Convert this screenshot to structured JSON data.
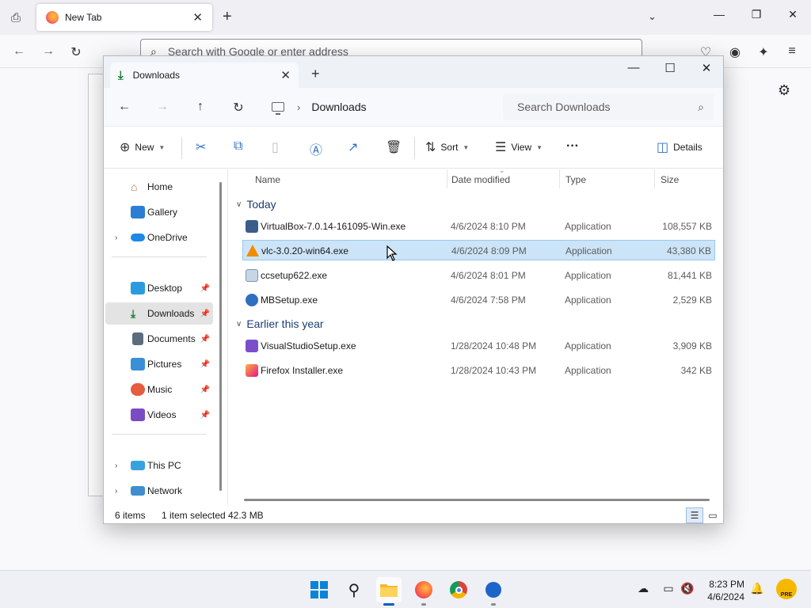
{
  "firefox": {
    "tab_title": "New Tab",
    "url_placeholder": "Search with Google or enter address"
  },
  "explorer": {
    "tab_title": "Downloads",
    "breadcrumb": "Downloads",
    "search_placeholder": "Search Downloads",
    "toolbar": {
      "new_label": "New",
      "sort_label": "Sort",
      "view_label": "View",
      "more_label": "···",
      "details_label": "Details"
    },
    "nav": {
      "home": "Home",
      "gallery": "Gallery",
      "onedrive": "OneDrive",
      "desktop": "Desktop",
      "downloads": "Downloads",
      "documents": "Documents",
      "pictures": "Pictures",
      "music": "Music",
      "videos": "Videos",
      "thispc": "This PC",
      "network": "Network"
    },
    "columns": {
      "name": "Name",
      "date": "Date modified",
      "type": "Type",
      "size": "Size"
    },
    "groups": {
      "today": "Today",
      "earlier": "Earlier this year"
    },
    "files": [
      {
        "name": "VirtualBox-7.0.14-161095-Win.exe",
        "date": "4/6/2024 8:10 PM",
        "type": "Application",
        "size": "108,557 KB"
      },
      {
        "name": "vlc-3.0.20-win64.exe",
        "date": "4/6/2024 8:09 PM",
        "type": "Application",
        "size": "43,380 KB"
      },
      {
        "name": "ccsetup622.exe",
        "date": "4/6/2024 8:01 PM",
        "type": "Application",
        "size": "81,441 KB"
      },
      {
        "name": "MBSetup.exe",
        "date": "4/6/2024 7:58 PM",
        "type": "Application",
        "size": "2,529 KB"
      },
      {
        "name": "VisualStudioSetup.exe",
        "date": "1/28/2024 10:48 PM",
        "type": "Application",
        "size": "3,909 KB"
      },
      {
        "name": "Firefox Installer.exe",
        "date": "1/28/2024 10:43 PM",
        "type": "Application",
        "size": "342 KB"
      }
    ],
    "status": {
      "count": "6 items",
      "selected": "1 item selected",
      "selected_size": "42.3 MB"
    }
  },
  "taskbar": {
    "time": "8:23 PM",
    "date": "4/6/2024",
    "badge": "PRE"
  },
  "colors": {
    "accent": "#005fb8",
    "selection": "#cce4f7",
    "group_header": "#1d3d73"
  }
}
